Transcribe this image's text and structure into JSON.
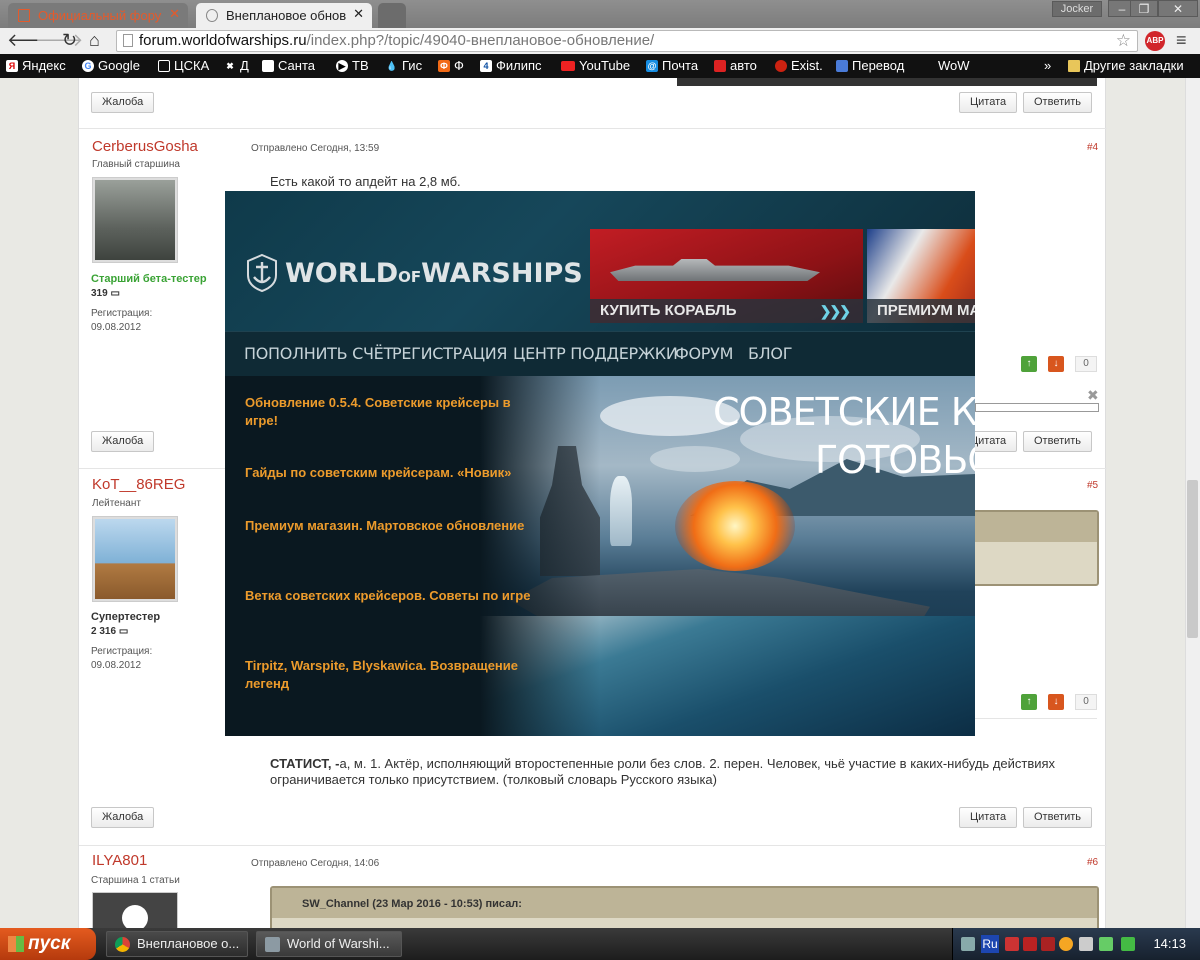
{
  "browser": {
    "tabs": [
      {
        "label": "Официальный фору"
      },
      {
        "label": "Внеплановое обнов"
      }
    ],
    "window_user": "Jocker",
    "url_host": "forum.worldofwarships.ru",
    "url_path": "/index.php?/topic/49040-внеплановое-обновление/",
    "abp_label": "ABP",
    "bookmarks": [
      "Яндекс",
      "Google",
      "ЦСКА",
      "Д",
      "Санта",
      "ТВ",
      "Гис",
      "Ф",
      "Филипс",
      "YouTube",
      "Почта",
      "авто",
      "Exist.",
      "Перевод",
      "WoW"
    ],
    "other_bookmarks": "Другие закладки"
  },
  "forum": {
    "buttons": {
      "complaint": "Жалоба",
      "quote": "Цитата",
      "reply": "Ответить"
    },
    "posts": [
      {
        "author": "CerberusGosha",
        "title": "Главный старшина",
        "rank": "Старший бета-тестер",
        "post_count": "319",
        "reg_label": "Регистрация:",
        "reg_date": "09.08.2012",
        "meta": "Отправлено Сегодня, 13:59",
        "number": "#4",
        "text": "Есть какой то апдейт на 2,8 мб.",
        "votes": "0"
      },
      {
        "author": "KoT__86REG",
        "title": "Лейтенант",
        "rank": "Супертестер",
        "post_count": "2 316",
        "reg_label": "Регистрация:",
        "reg_date": "09.08.2012",
        "number": "#5",
        "votes": "0",
        "signature_bold": "СТАТИСТ, -",
        "signature_text": "а, м. 1. Актёр, исполняющий второстепенные роли без слов. 2. перен. Человек, чьё участие в каких-нибудь действиях ограничивается только присутствием. (толковый словарь Русского языка)"
      },
      {
        "author": "ILYA801",
        "title": "Старшина 1 статьи",
        "meta": "Отправлено Сегодня, 14:06",
        "number": "#6",
        "quote_header": "SW_Channel (23 Мар 2016 - 10:53) писал:"
      }
    ]
  },
  "overlay": {
    "logo_world": "WORLD",
    "logo_of": "OF",
    "logo_warships": "WARSHIPS",
    "banner_buy": "КУПИТЬ КОРАБЛЬ",
    "banner_premium": "ПРЕМИУМ МА",
    "nav": [
      "ПОПОЛНИТЬ СЧЁТ",
      "РЕГИСТРАЦИЯ",
      "ЦЕНТР ПОДДЕРЖКИ",
      "ФОРУМ",
      "БЛОГ"
    ],
    "headline_1": "СОВЕТСКИЕ КР",
    "headline_2": "ГОТОВЬС",
    "news": [
      "Обновление 0.5.4. Советские крейсеры в игре!",
      "Гайды по советским крейсерам. «Новик»",
      "Премиум магазин. Мартовское обновление",
      "Ветка советских крейсеров. Советы по игре",
      "Tirpitz, Warspite, Blyskawica. Возвращение легенд"
    ]
  },
  "taskbar": {
    "start_label": "пуск",
    "tasks": [
      "Внеплановое о...",
      "World of Warshi..."
    ],
    "lang": "Ru",
    "clock": "14:13"
  },
  "colors": {
    "accent_orange": "#ec9b2c",
    "author_red": "#c0392b",
    "rank_green": "#3aa335"
  }
}
